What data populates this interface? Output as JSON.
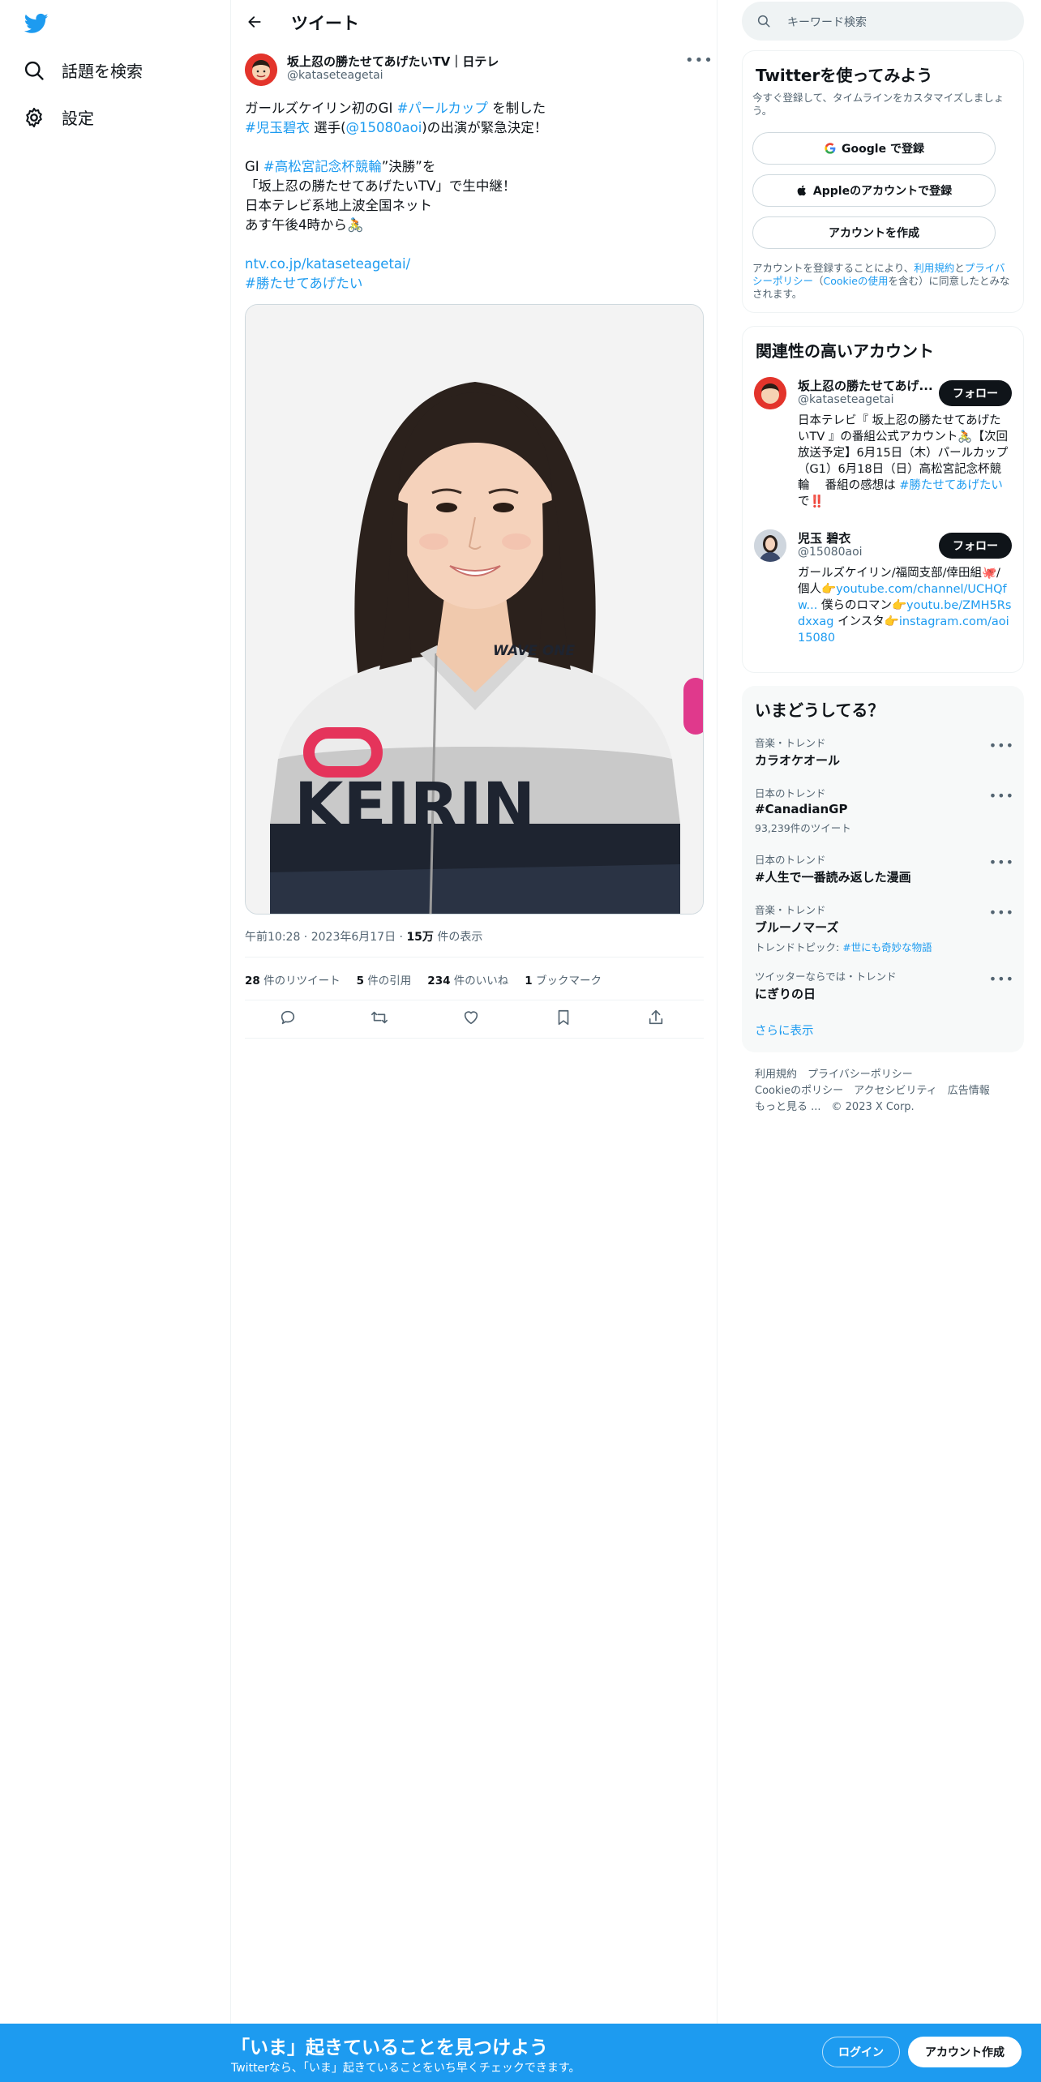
{
  "nav": {
    "explore_label": "話題を検索",
    "settings_label": "設定"
  },
  "header": {
    "title": "ツイート"
  },
  "tweet": {
    "author_name": "坂上忍の勝たせてあげたいTV｜日テレ",
    "author_handle": "@kataseteagetai",
    "line1_a": "ガールズケイリン初のGI ",
    "line1_link": "#パールカップ",
    "line1_b": " を制した",
    "line2_link": "#児玉碧衣",
    "line2_a": " 選手(",
    "line2_mention": "@15080aoi",
    "line2_b": ")の出演が緊急決定！",
    "line3_a": "GI ",
    "line3_link": "#高松宮記念杯競輪",
    "line3_b": "”決勝”を",
    "line4": "「坂上忍の勝たせてあげたいTV」で生中継！",
    "line5": "日本テレビ系地上波全国ネット",
    "line6": "あす午後4時から🚴",
    "url": "ntv.co.jp/kataseteagetai/",
    "hashtag_end": "#勝たせてあげたい",
    "time": "午前10:28",
    "date": "2023年6月17日",
    "views_count": "15万",
    "views_label": " 件の表示",
    "retweets_count": "28",
    "retweets_label": " 件のリツイート",
    "quotes_count": "5",
    "quotes_label": " 件の引用",
    "likes_count": "234",
    "likes_label": " 件のいいね",
    "bookmarks_count": "1",
    "bookmarks_label": " ブックマーク",
    "photo_logo_text": "WAVE ONE",
    "photo_jersey_text": "KEIRIN"
  },
  "search": {
    "placeholder": "キーワード検索"
  },
  "signup": {
    "title": "Twitterを使ってみよう",
    "desc": "今すぐ登録して、タイムラインをカスタマイズしましょう。",
    "google_label": "Google で登録",
    "apple_label": "Appleのアカウントで登録",
    "create_label": "アカウントを作成",
    "terms_a": "アカウントを登録することにより、",
    "terms_link1": "利用規約",
    "terms_b": "と",
    "terms_link2": "プライバシーポリシー",
    "terms_c": "（",
    "terms_link3": "Cookieの使用",
    "terms_d": "を含む）に同意したとみなされます。"
  },
  "related": {
    "title": "関連性の高いアカウント",
    "follow_label": "フォロー",
    "accounts": [
      {
        "name": "坂上忍の勝たせてあげ...",
        "handle": "@kataseteagetai",
        "bio_a": "日本テレビ『 坂上忍の勝たせてあげたいTV 』の番組公式アカウント🚴【次回放送予定】6月15日（木）パールカップ（G1）6月18日（日）高松宮記念杯競輪　 番組の感想は ",
        "bio_link": "#勝たせてあげたい",
        "bio_b": " で‼️"
      },
      {
        "name": "児玉 碧衣",
        "handle": "@15080aoi",
        "bio_a": "ガールズケイリン/福岡支部/倖田組🐙/個人👉",
        "bio_link1": "youtube.com/channel/UCHQfw...",
        "bio_b": " 僕らのロマン👉",
        "bio_link2": "youtu.be/ZMH5Rsdxxag",
        "bio_c": " インスタ👉",
        "bio_link3": "instagram.com/aoi15080"
      }
    ]
  },
  "trends": {
    "title": "いまどうしてる？",
    "items": [
      {
        "category": "音楽・トレンド",
        "title": "カラオケオール",
        "sub": ""
      },
      {
        "category": "日本のトレンド",
        "title": "#CanadianGP",
        "sub": "93,239件のツイート"
      },
      {
        "category": "日本のトレンド",
        "title": "#人生で一番読み返した漫画",
        "sub": ""
      },
      {
        "category": "音楽・トレンド",
        "title": "ブルーノマーズ",
        "sub_a": "トレンドトピック: ",
        "sub_link": "#世にも奇妙な物語"
      },
      {
        "category": "ツイッターならでは・トレンド",
        "title": "にぎりの日",
        "sub": ""
      }
    ],
    "show_more": "さらに表示"
  },
  "footer": {
    "line1": "利用規約　プライバシーポリシー",
    "line2": "Cookieのポリシー　アクセシビリティ　広告情報",
    "line3": "もっと見る ...　© 2023 X Corp."
  },
  "bottombar": {
    "title": "「いま」起きていることを見つけよう",
    "subtitle": "Twitterなら、「いま」起きていることをいち早くチェックできます。",
    "login_label": "ログイン",
    "signup_label": "アカウント作成"
  },
  "colors": {
    "accent": "#1d9bf0",
    "text": "#0f1419",
    "muted": "#536471"
  }
}
